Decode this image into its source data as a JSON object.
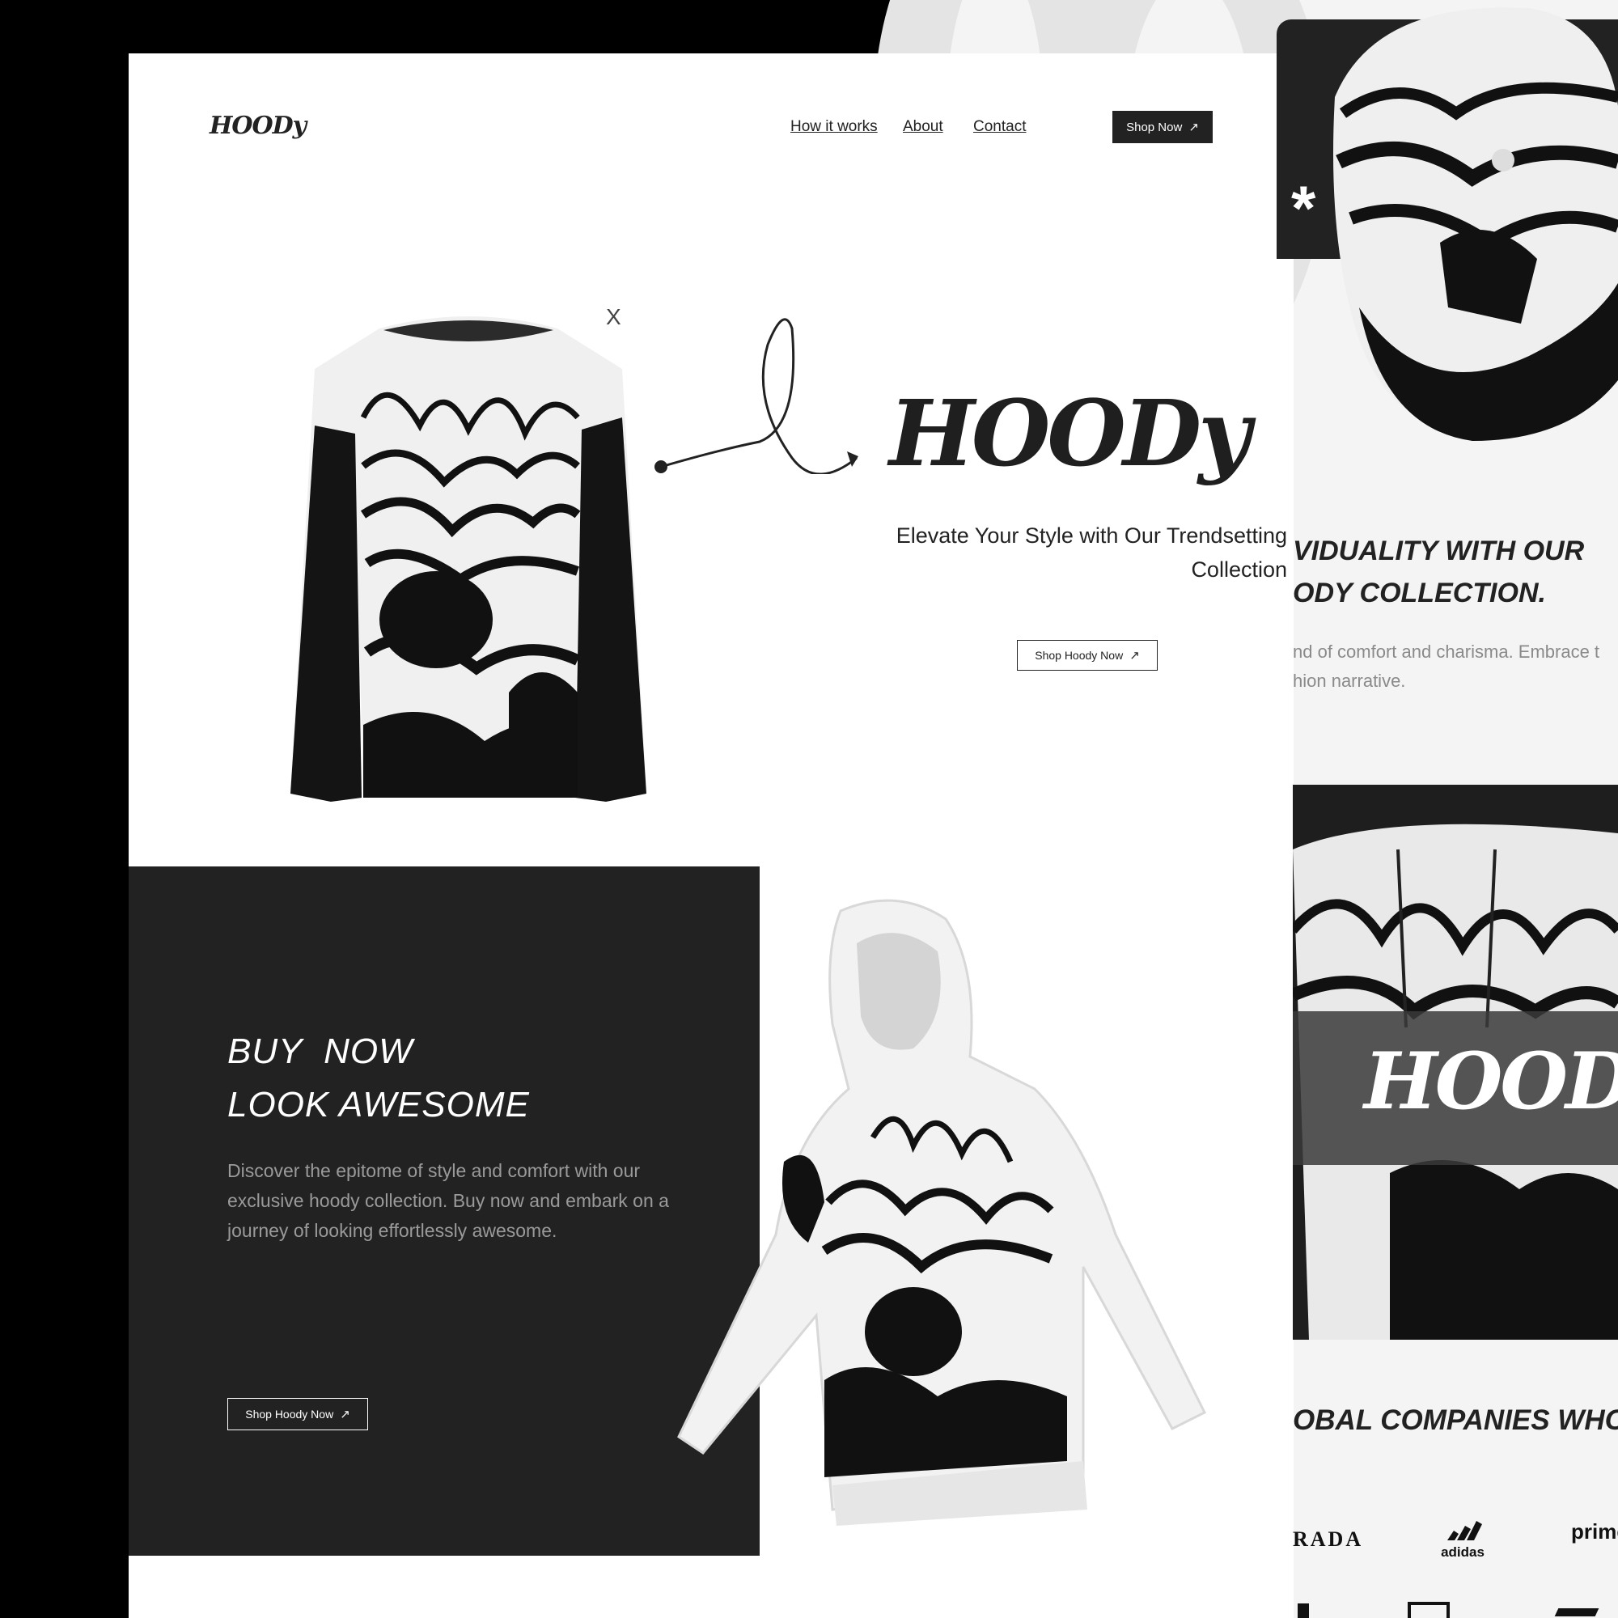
{
  "colors": {
    "dark": "#222222",
    "black": "#000000",
    "white": "#ffffff",
    "muted": "#9a9a9a"
  },
  "header": {
    "logo": "HOODy",
    "nav": [
      {
        "label": "How it works"
      },
      {
        "label": "About"
      },
      {
        "label": "Contact"
      }
    ],
    "cta_label": "Shop Now",
    "cta_icon": "arrow-up-right-icon"
  },
  "hero": {
    "title": "HOODy",
    "subtitle_line1": "Elevate Your Style with Our Trendsetting",
    "subtitle_line2": "Collection",
    "cta_label": "Shop Hoody Now",
    "shirt_tag": "X"
  },
  "promo": {
    "title_line1": "BUY  NOW",
    "title_line2": "LOOK AWESOME",
    "text": "Discover the epitome of style and comfort with our exclusive hoody collection. Buy now and embark on a journey of looking effortlessly awesome.",
    "cta_label": "Shop Hoody Now"
  },
  "side": {
    "asterisk": "*",
    "heading_line1": "VIDUALITY WITH OUR",
    "heading_line2": "ODY COLLECTION.",
    "text_line1": "nd of comfort and charisma. Embrace t",
    "text_line2": "hion narrative.",
    "photo_label": "HOODy",
    "companies_heading": "OBAL COMPANIES WHO",
    "brands": [
      "RADA",
      "adidas",
      "prime"
    ]
  }
}
